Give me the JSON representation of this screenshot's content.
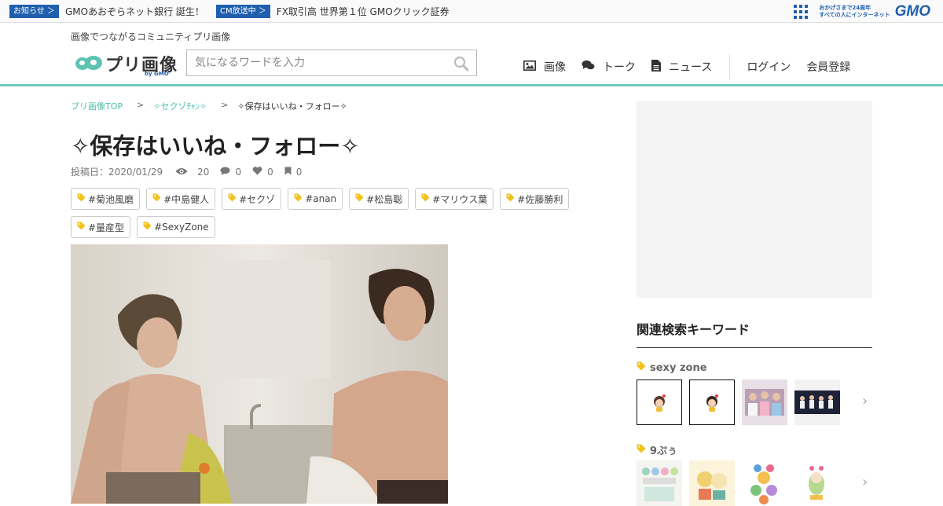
{
  "gmo_bar": {
    "news": [
      {
        "tag": "お知らせ ＞",
        "text": "GMOあおぞらネット銀行 誕生！"
      },
      {
        "tag": "CM放送中 ＞",
        "text": "FX取引高 世界第１位 GMOクリック証券"
      }
    ],
    "tagline_line1": "おかげさまで24周年",
    "tagline_line2": "すべての人にインターネット",
    "logo": "GMO"
  },
  "header": {
    "tagline": "画像でつながるコミュニティプリ画像",
    "logo_text": "プリ画像",
    "logo_by": "by GMO",
    "search_placeholder": "気になるワードを入力",
    "nav": [
      {
        "label": "画像",
        "icon": "image-icon"
      },
      {
        "label": "トーク",
        "icon": "comments-icon"
      },
      {
        "label": "ニュース",
        "icon": "document-icon"
      }
    ],
    "login": "ログイン",
    "register": "会員登録"
  },
  "breadcrumb": {
    "home": "プリ画像TOP",
    "sep": ">",
    "category": "✧セクゾﾁｬﾝ✧",
    "current": "✧保存はいいね・フォロー✧"
  },
  "post": {
    "title": "✧保存はいいね・フォロー✧",
    "date": "投稿日：2020/01/29",
    "views": "20",
    "comments": "0",
    "likes": "0",
    "bookmarks": "0",
    "tags": [
      "#菊池風磨",
      "#中島健人",
      "#セクゾ",
      "#anan",
      "#松島聡",
      "#マリウス葉",
      "#佐藤勝利",
      "#量産型",
      "#SexyZone"
    ]
  },
  "sidebar": {
    "related_title": "関連検索キーワード",
    "keywords": [
      {
        "label": "sexy zone"
      },
      {
        "label": "9ぷぅ"
      }
    ]
  },
  "colors": {
    "accent": "#4cbfaa",
    "header_border": "#6cc9b8",
    "gmo_blue": "#1f5fad",
    "tag_icon": "#f2c21b"
  }
}
